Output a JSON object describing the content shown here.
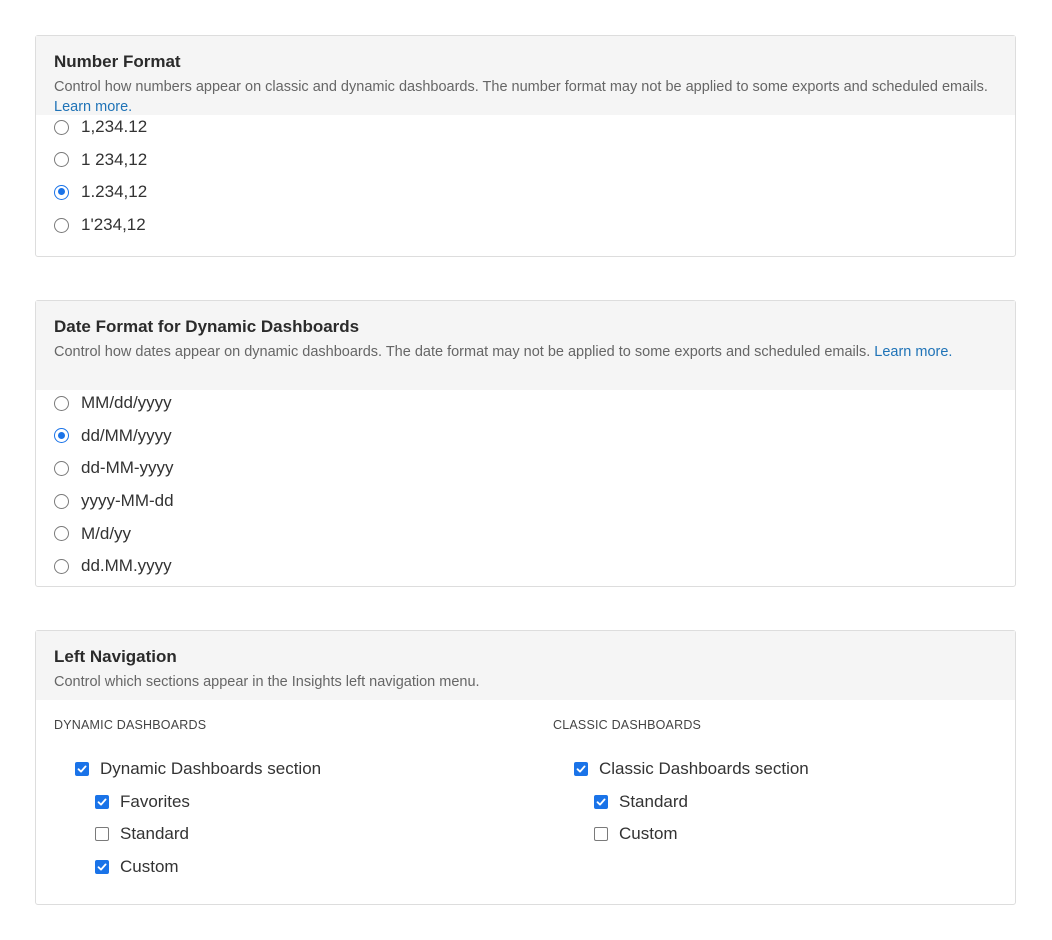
{
  "number_format": {
    "title": "Number Format",
    "description": "Control how numbers appear on classic and dynamic dashboards. The number format may not be applied to some exports and scheduled emails.",
    "learn_more": "Learn more.",
    "options": [
      {
        "label": "1,234.12",
        "checked": false
      },
      {
        "label": "1 234,12",
        "checked": false
      },
      {
        "label": "1.234,12",
        "checked": true
      },
      {
        "label": "1'234,12",
        "checked": false
      }
    ]
  },
  "date_format": {
    "title": "Date Format for Dynamic Dashboards",
    "description": "Control how dates appear on dynamic dashboards. The date format may not be applied to some exports and scheduled emails.",
    "learn_more": "Learn more.",
    "options": [
      {
        "label": "MM/dd/yyyy",
        "checked": false
      },
      {
        "label": "dd/MM/yyyy",
        "checked": true
      },
      {
        "label": "dd-MM-yyyy",
        "checked": false
      },
      {
        "label": "yyyy-MM-dd",
        "checked": false
      },
      {
        "label": "M/d/yy",
        "checked": false
      },
      {
        "label": "dd.MM.yyyy",
        "checked": false
      }
    ]
  },
  "left_navigation": {
    "title": "Left Navigation",
    "description": "Control which sections appear in the Insights left navigation menu.",
    "dynamic": {
      "header": "DYNAMIC DASHBOARDS",
      "section": {
        "label": "Dynamic Dashboards section",
        "checked": true
      },
      "items": [
        {
          "label": "Favorites",
          "checked": true
        },
        {
          "label": "Standard",
          "checked": false
        },
        {
          "label": "Custom",
          "checked": true
        }
      ]
    },
    "classic": {
      "header": "CLASSIC DASHBOARDS",
      "section": {
        "label": "Classic Dashboards section",
        "checked": true
      },
      "items": [
        {
          "label": "Standard",
          "checked": true
        },
        {
          "label": "Custom",
          "checked": false
        }
      ]
    }
  },
  "colors": {
    "accent": "#1a73e8",
    "link": "#1f73b7",
    "header_bg": "#f5f5f5",
    "border": "#dddddd"
  }
}
